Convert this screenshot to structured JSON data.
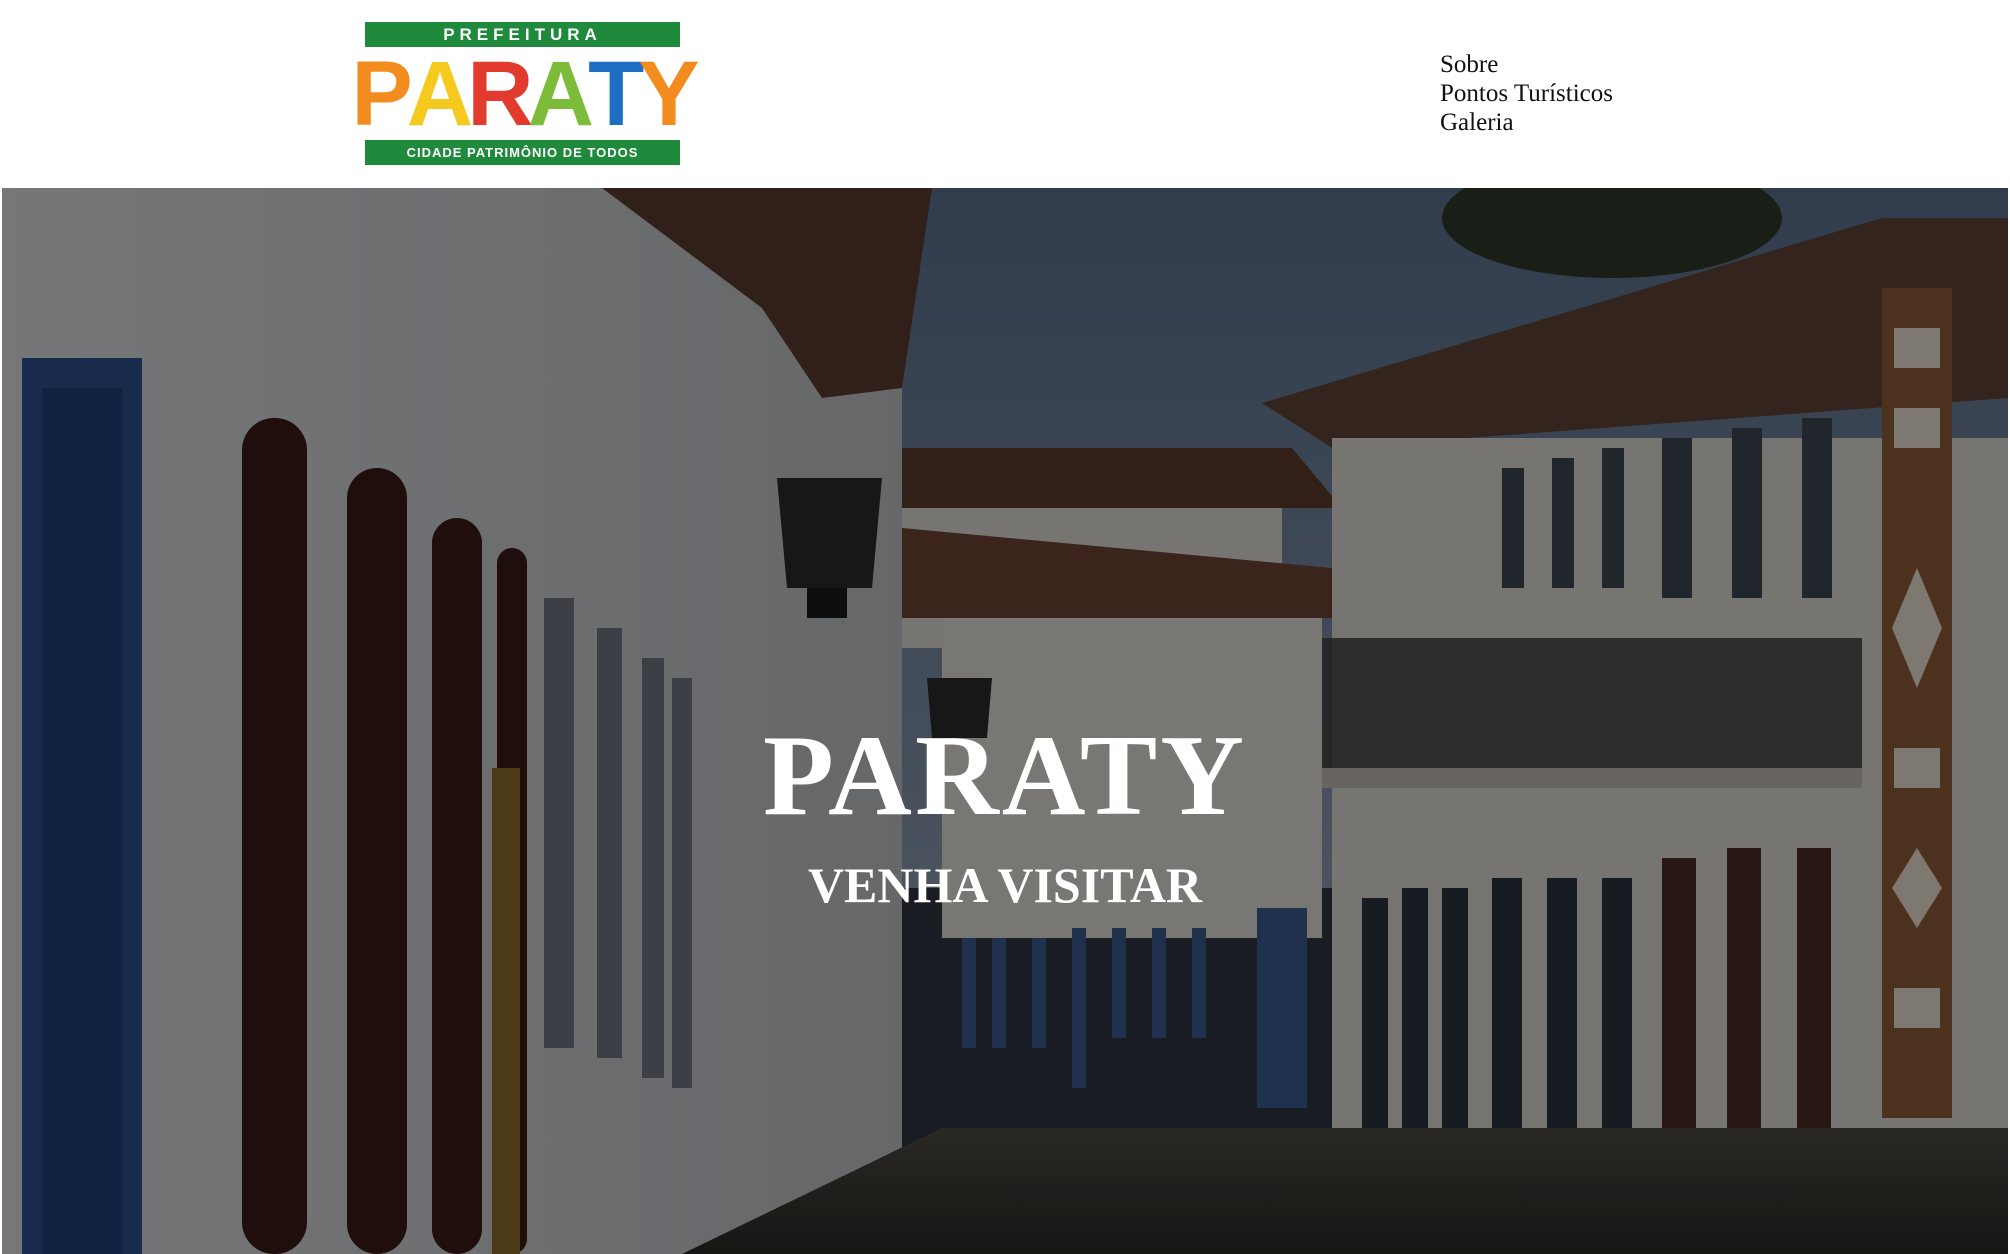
{
  "header": {
    "logo": {
      "top_text": "PREFEITURA",
      "letters": [
        {
          "char": "P",
          "color": "#f28c1e"
        },
        {
          "char": "A",
          "color": "#f6c91e"
        },
        {
          "char": "R",
          "color": "#e23b2e"
        },
        {
          "char": "A",
          "color": "#7dbb3a"
        },
        {
          "char": "T",
          "color": "#1e6fc4"
        },
        {
          "char": "Y",
          "color": "#f28c1e"
        }
      ],
      "bottom_text": "CIDADE PATRIMÔNIO DE TODOS"
    },
    "nav": {
      "items": [
        {
          "label": "Sobre"
        },
        {
          "label": "Pontos Turísticos"
        },
        {
          "label": "Galeria"
        }
      ]
    }
  },
  "hero": {
    "title": "PARATY",
    "subtitle": "VENHA VISITAR"
  },
  "colors": {
    "logo_green": "#1f8a3c",
    "hero_overlay": "#000000"
  }
}
